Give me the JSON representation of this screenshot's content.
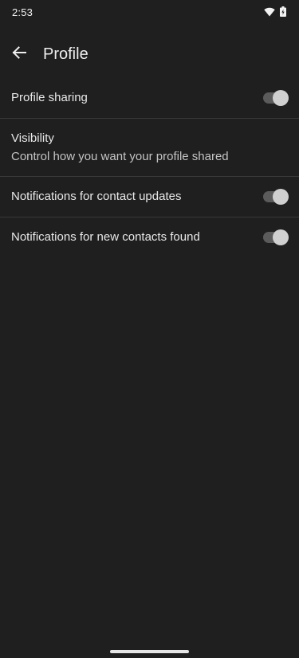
{
  "status_bar": {
    "time": "2:53",
    "icons": [
      "wifi-icon",
      "battery-icon"
    ]
  },
  "app_bar": {
    "back_icon": "arrow-back-icon",
    "title": "Profile"
  },
  "settings": [
    {
      "label": "Profile sharing",
      "toggle": true,
      "toggle_on": false
    },
    {
      "label": "Visibility",
      "subtitle": "Control how you want your profile shared"
    },
    {
      "label": "Notifications for contact updates",
      "toggle": true,
      "toggle_on": false
    },
    {
      "label": "Notifications for new contacts found",
      "toggle": true,
      "toggle_on": false
    }
  ],
  "colors": {
    "background": "#1f1f1f",
    "divider": "#3a3a3a",
    "toggle_track": "#5b5b5b",
    "toggle_knob": "#d0d0d0"
  }
}
